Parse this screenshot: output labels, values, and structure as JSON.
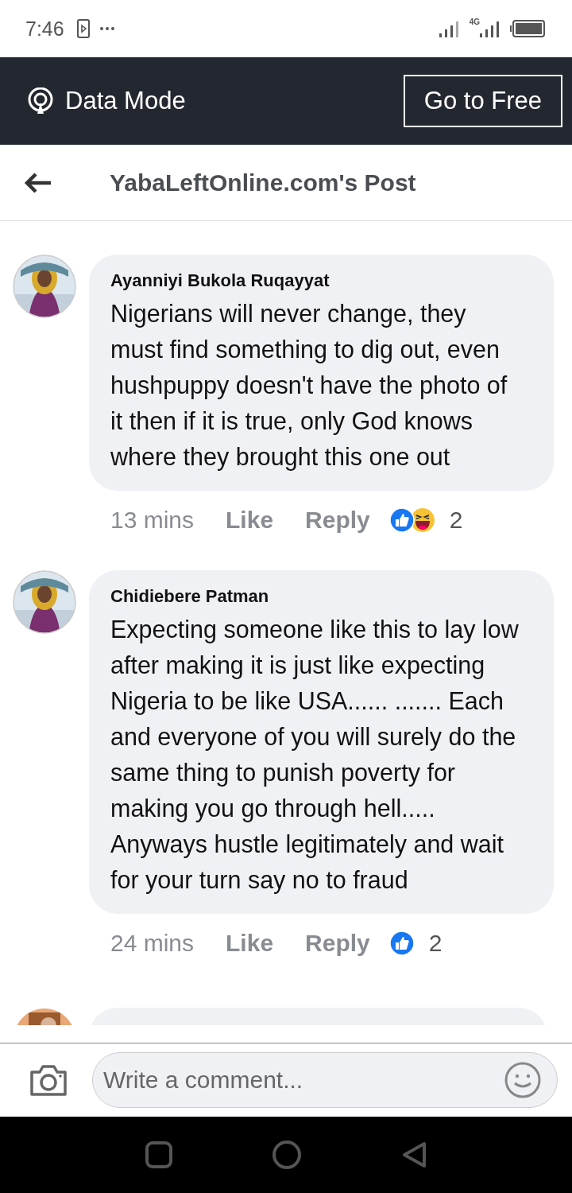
{
  "status_bar": {
    "time": "7:46",
    "network": "4G"
  },
  "mode_bar": {
    "label": "Data Mode",
    "button": "Go to Free"
  },
  "title_bar": {
    "title": "YabaLeftOnline.com's Post"
  },
  "comments": [
    {
      "author": "Ayanniyi Bukola Ruqayyat",
      "text": "Nigerians will never change, they must find something to dig out, even hushpuppy doesn't have the photo of it then if it is true, only God knows where they brought this one out",
      "time": "13 mins",
      "like": "Like",
      "reply": "Reply",
      "reactions": [
        {
          "kind": "like"
        },
        {
          "kind": "haha"
        }
      ],
      "count": "2"
    },
    {
      "author": "Chidiebere Patman",
      "text": "Expecting someone like this to lay low after making it is just like expecting Nigeria to be like USA...... ....... Each and everyone of you will surely do the same thing to punish poverty for making you go through hell..... Anyways hustle legitimately and wait for your turn say no to fraud",
      "time": "24 mins",
      "like": "Like",
      "reply": "Reply",
      "reactions": [
        {
          "kind": "like"
        }
      ],
      "count": "2"
    }
  ],
  "composer": {
    "placeholder": "Write a comment..."
  }
}
